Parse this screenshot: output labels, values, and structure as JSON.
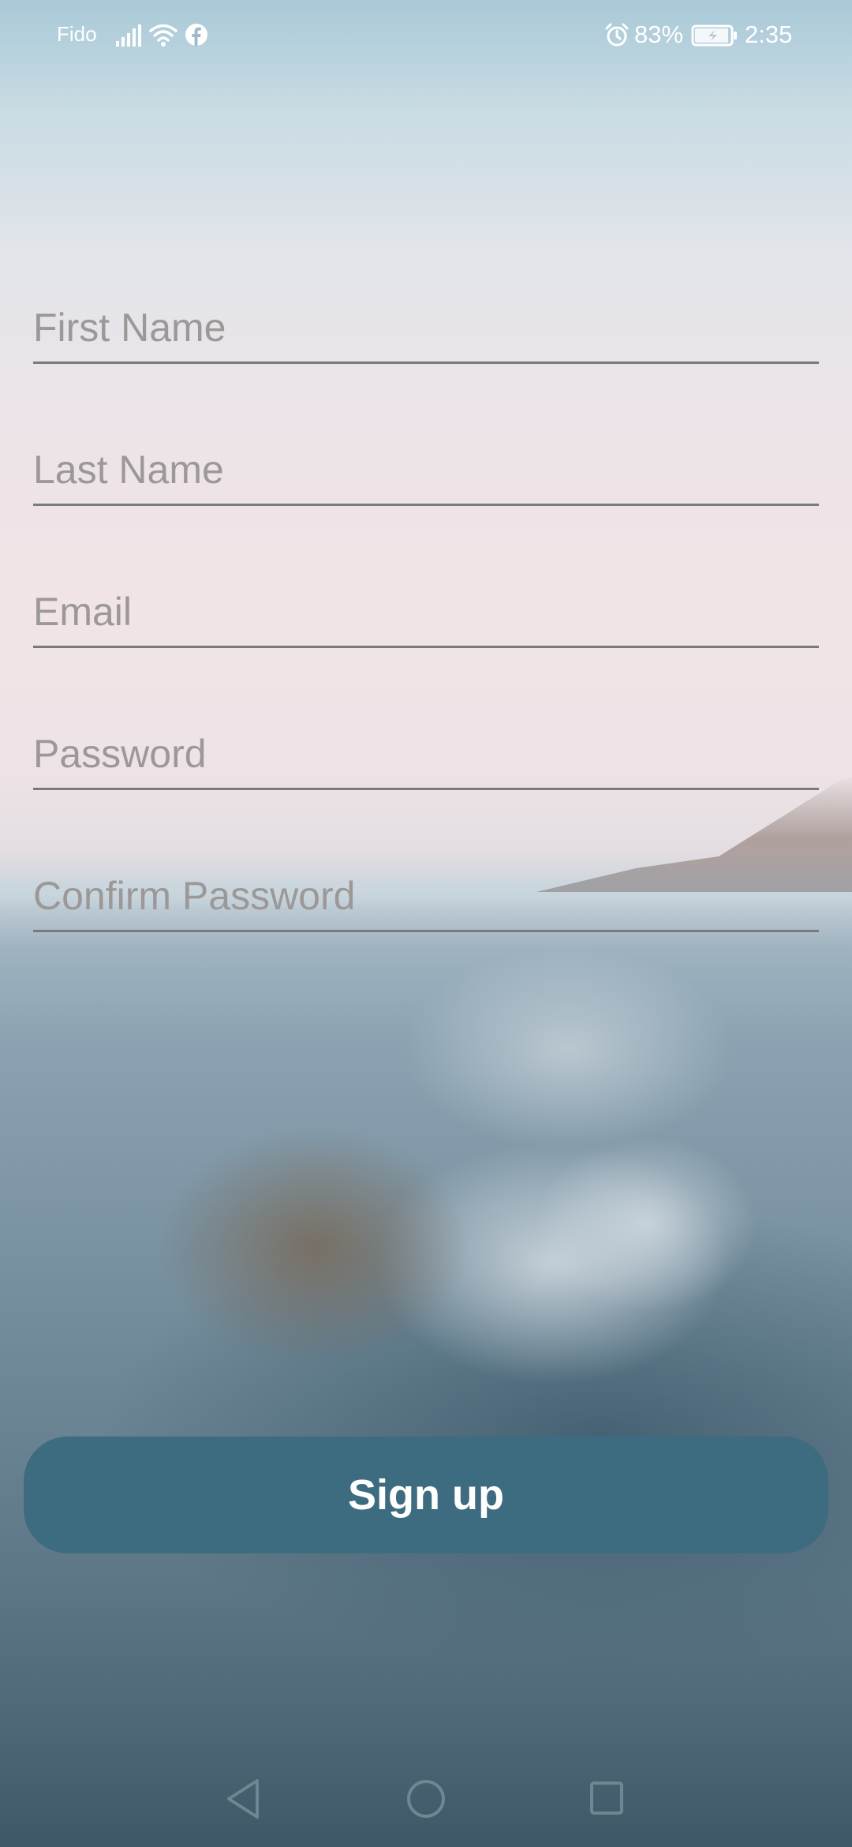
{
  "status_bar": {
    "carrier": "Fido",
    "battery_percent": "83%",
    "time": "2:35",
    "icons": [
      "signal-icon",
      "wifi-icon",
      "facebook-icon",
      "alarm-icon",
      "battery-charging-icon"
    ]
  },
  "form": {
    "fields": [
      {
        "name": "first-name-field",
        "placeholder": "First Name",
        "value": ""
      },
      {
        "name": "last-name-field",
        "placeholder": "Last Name",
        "value": ""
      },
      {
        "name": "email-field",
        "placeholder": "Email",
        "value": ""
      },
      {
        "name": "password-field",
        "placeholder": "Password",
        "value": ""
      },
      {
        "name": "confirm-password-field",
        "placeholder": "Confirm Password",
        "value": ""
      }
    ],
    "submit_label": "Sign up"
  },
  "nav_bar": {
    "icons": [
      "back-icon",
      "home-icon",
      "recent-apps-icon"
    ]
  },
  "colors": {
    "button": "#3d6b80",
    "underline": "#7a7a7a",
    "placeholder": "#9c9898"
  }
}
